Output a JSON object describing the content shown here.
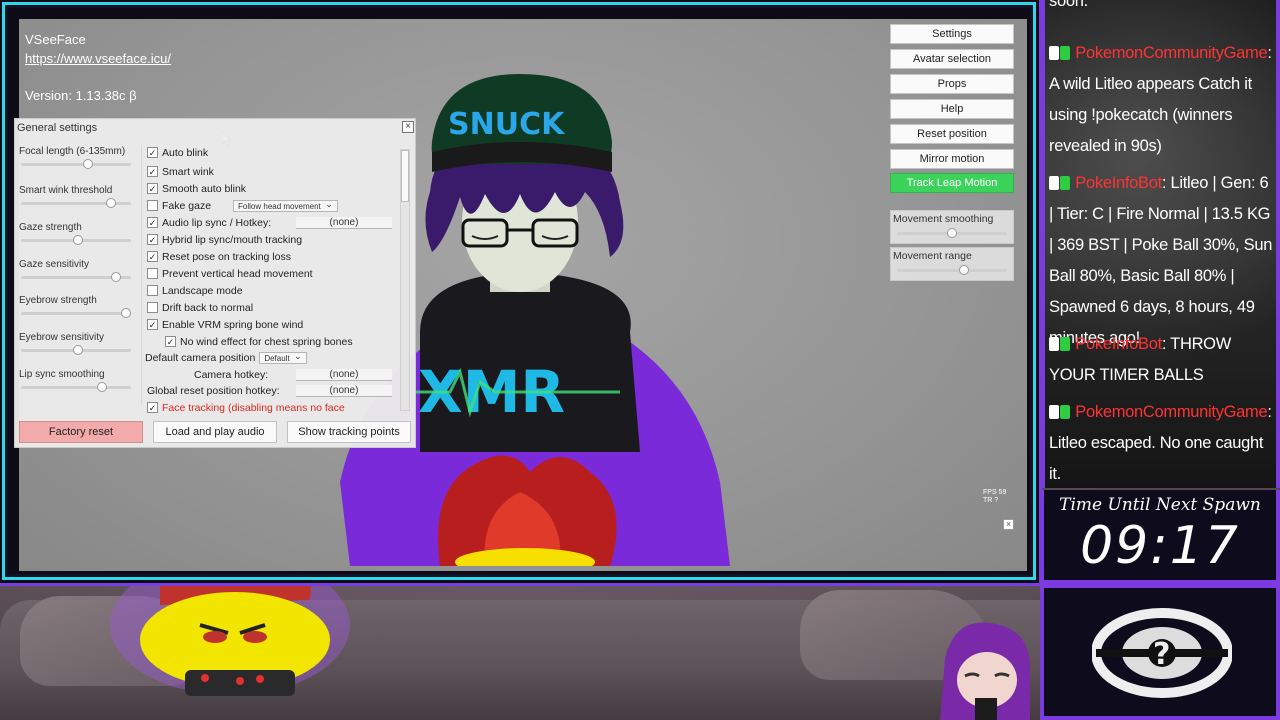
{
  "app": {
    "name": "VSeeFace",
    "url": "https://www.vseeface.icu/",
    "version": "Version: 1.13.38c β"
  },
  "settings_panel": {
    "title": "General settings",
    "close_glyph": "×",
    "sliders": [
      {
        "label": "Focal length (6-135mm)",
        "value": 0.62
      },
      {
        "label": "Smart wink threshold",
        "value": 0.85
      },
      {
        "label": "Gaze strength",
        "value": 0.52
      },
      {
        "label": "Gaze sensitivity",
        "value": 0.9
      },
      {
        "label": "Eyebrow strength",
        "value": 1.0
      },
      {
        "label": "Eyebrow sensitivity",
        "value": 0.52
      },
      {
        "label": "Lip  sync smoothing",
        "value": 0.76
      }
    ],
    "options": [
      {
        "label": "Auto blink",
        "checked": true
      },
      {
        "label": "Smart wink",
        "checked": true
      },
      {
        "label": "Smooth auto blink",
        "checked": true
      },
      {
        "label": "Fake gaze",
        "checked": false,
        "dropdown": "Follow head movement"
      },
      {
        "label": "Audio lip sync / Hotkey:",
        "checked": true,
        "hotkey": "(none)"
      },
      {
        "label": "Hybrid lip sync/mouth tracking",
        "checked": true
      },
      {
        "label": "Reset pose on tracking loss",
        "checked": true
      },
      {
        "label": "Prevent vertical head movement",
        "checked": false
      },
      {
        "label": "Landscape mode",
        "checked": false
      },
      {
        "label": "Drift back to normal",
        "checked": false
      },
      {
        "label": "Enable VRM spring bone wind",
        "checked": true
      },
      {
        "label": "No wind effect for chest spring bones",
        "checked": true
      }
    ],
    "camera_position_label": "Default camera position",
    "camera_position_value": "Default",
    "camera_hotkey_label": "Camera hotkey:",
    "camera_hotkey_value": "(none)",
    "global_reset_label": "Global reset position hotkey:",
    "global_reset_value": "(none)",
    "face_tracking_label": "Face tracking (disabling means no face",
    "buttons": {
      "factory_reset": "Factory reset",
      "load_audio": "Load and play audio",
      "show_tracking": "Show tracking points"
    }
  },
  "menu": {
    "settings": "Settings",
    "avatar_selection": "Avatar selection",
    "props": "Props",
    "help": "Help",
    "reset_position": "Reset position",
    "mirror_motion": "Mirror motion",
    "track_leap_motion": "Track Leap Motion",
    "movement_smoothing": "Movement smoothing",
    "movement_smoothing_value": 0.5,
    "movement_range": "Movement range",
    "movement_range_value": 0.62
  },
  "status": {
    "fps": "FPS 59",
    "tr": "TR  ?"
  },
  "chat": {
    "messages": [
      {
        "user": "PokemonCommunityGame",
        "text": ": A wild Litleo appears Catch it using !pokecatch (winners revealed in 90s)"
      },
      {
        "user": "PokeInfoBot",
        "text": ": Litleo | Gen: 6 | Tier: C | Fire Normal | 13.5 KG | 369 BST | Poke Ball 30%, Sun Ball 80%, Basic Ball 80% | Spawned 6 days, 8 hours, 49 minutes ago!"
      },
      {
        "user": "PokeInfoBot",
        "text": ": THROW YOUR TIMER BALLS"
      },
      {
        "user": "PokemonCommunityGame",
        "text": ": Litleo escaped. No one caught it."
      }
    ]
  },
  "spawn_timer": {
    "title": "Time Until Next Spawn",
    "value": "09:17"
  },
  "colors": {
    "frame_accent": "#2fd8e8",
    "overlay_purple": "#7c3be0",
    "active_green": "#3bd35a",
    "factory_reset_red": "#f3aaaa",
    "chat_username": "#ff3333",
    "face_tracking_text": "#e0281e"
  }
}
